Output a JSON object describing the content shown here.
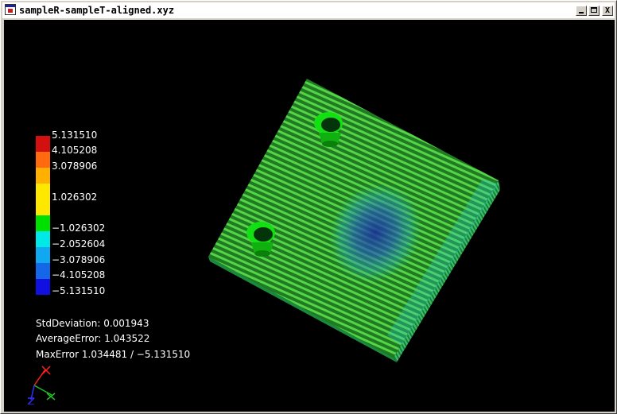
{
  "window": {
    "title": "sampleR-sampleT-aligned.xyz",
    "controls": {
      "minimize": "_",
      "maximize": "□",
      "close": "X"
    }
  },
  "legend": {
    "labels": [
      "5.131510",
      "4.105208",
      "3.078906",
      "1.026302",
      "−1.026302",
      "−2.052604",
      "−3.078906",
      "−4.105208",
      "−5.131510"
    ],
    "colors": [
      "#d21010",
      "#ff6a10",
      "#ffb000",
      "#ffe800",
      "#00e000",
      "#00e8e8",
      "#10a8f0",
      "#1468e8",
      "#1010e0"
    ]
  },
  "stats": {
    "std_deviation": "StdDeviation: 0.001943",
    "average_error": "AverageError: 1.043522",
    "max_error": "MaxError 1.034481 / −5.131510"
  },
  "colors": {
    "background": "#000000",
    "cloud_green": "#3cc83c",
    "cloud_cyan": "#30d8d0",
    "cloud_blue": "#3060d0",
    "hole_green": "#10e010"
  },
  "axes": {
    "icon": "xyz-axis-icon"
  }
}
